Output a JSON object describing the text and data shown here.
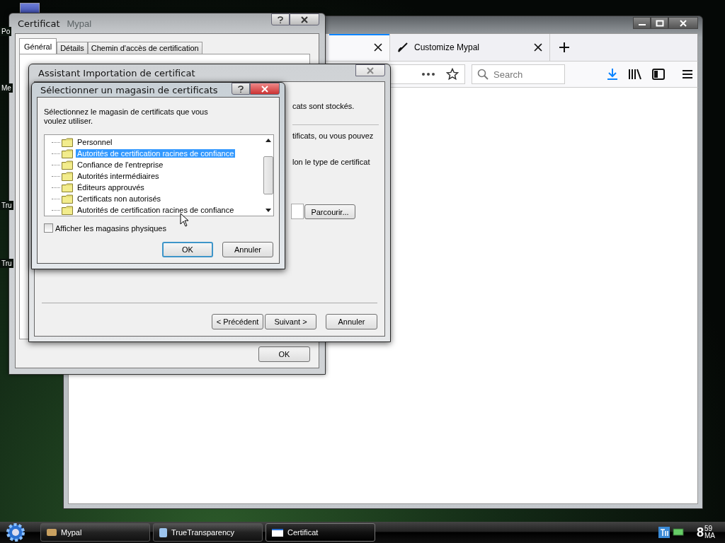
{
  "desktop": {
    "icon_labels": [
      {
        "label": "Po"
      },
      {
        "label": "Me"
      },
      {
        "label": "Tru"
      },
      {
        "label": "Tru"
      }
    ]
  },
  "browser": {
    "tabs": [
      {
        "selected": true
      },
      {
        "label": "Customize Mypal",
        "selected": false
      }
    ],
    "search": {
      "placeholder": "Search"
    }
  },
  "certificate_window": {
    "title": "Certificat",
    "ghost_title": "Mypal",
    "tabs": [
      {
        "label": "Général",
        "selected": true
      },
      {
        "label": "Détails",
        "selected": false
      },
      {
        "label": "Chemin d'accès de certification",
        "selected": false
      }
    ],
    "ok_button": "OK"
  },
  "import_wizard": {
    "title": "Assistant Importation de certificat",
    "text_fragments": [
      "cats sont stockés.",
      "tificats, ou vous pouvez",
      "lon le type de certificat"
    ],
    "browse_button": "Parcourir...",
    "buttons": [
      "< Précédent",
      "Suivant >",
      "Annuler"
    ]
  },
  "store_dialog": {
    "title": "Sélectionner un magasin de certificats",
    "prompt": "Sélectionnez le magasin de certificats que vous voulez utiliser.",
    "stores": [
      {
        "label": "Personnel",
        "selected": false
      },
      {
        "label": "Autorités de certification racines de confiance",
        "selected": true
      },
      {
        "label": "Confiance de l'entreprise",
        "selected": false
      },
      {
        "label": "Autorités intermédiaires",
        "selected": false
      },
      {
        "label": "Éditeurs approuvés",
        "selected": false
      },
      {
        "label": "Certificats non autorisés",
        "selected": false
      },
      {
        "label": "Autorités de certification racines de confiance",
        "selected": false
      }
    ],
    "show_physical": {
      "label": "Afficher les magasins physiques",
      "checked": false
    },
    "buttons": [
      {
        "label": "OK",
        "default": true
      },
      {
        "label": "Annuler",
        "default": false
      }
    ]
  },
  "taskbar": {
    "tasks": [
      {
        "label": "Mypal",
        "selected": false
      },
      {
        "label": "TrueTransparency",
        "selected": false
      },
      {
        "label": "Certificat",
        "selected": true
      }
    ],
    "clock": {
      "hour": "8",
      "minute": "59",
      "period": "MA"
    }
  }
}
